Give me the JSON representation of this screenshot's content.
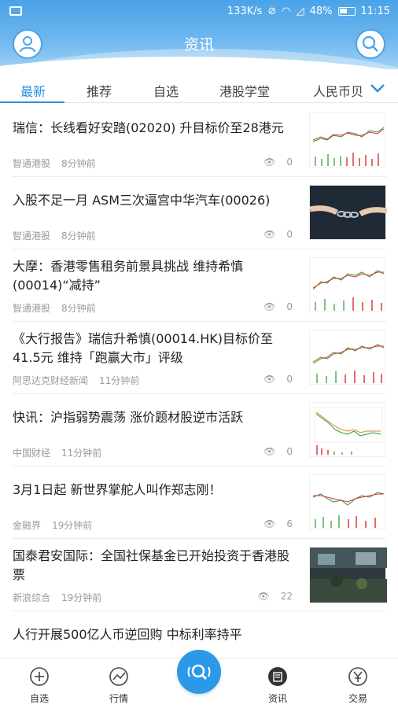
{
  "status_bar": {
    "speed": "133K/s",
    "battery": "48%",
    "time": "11:15"
  },
  "header": {
    "title": "资讯"
  },
  "tabs": [
    {
      "label": "最新",
      "active": true
    },
    {
      "label": "推荐"
    },
    {
      "label": "自选"
    },
    {
      "label": "港股学堂"
    },
    {
      "label": "人民币贝"
    }
  ],
  "news": [
    {
      "title": "瑞信：长线看好安踏(02020) 升目标价至28港元",
      "source": "智通港股",
      "time": "8分钟前",
      "views": "0",
      "thumb": "stock-chart"
    },
    {
      "title": "入股不足一月 ASM三次逼宫中华汽车(00026)",
      "source": "智通港股",
      "time": "8分钟前",
      "views": "0",
      "thumb": "chain-hands-photo"
    },
    {
      "title": "大摩：香港零售租务前景具挑战 维持希慎(00014)“减持”",
      "source": "智通港股",
      "time": "8分钟前",
      "views": "0",
      "thumb": "stock-chart"
    },
    {
      "title": "《大行报告》瑞信升希慎(00014.HK)目标价至41.5元 维持「跑赢大市」评级",
      "source": "阿思达克财经新闻",
      "time": "11分钟前",
      "views": "0",
      "thumb": "stock-chart"
    },
    {
      "title": "快讯：沪指弱势震荡 涨价题材股逆市活跃",
      "source": "中国财经",
      "time": "11分钟前",
      "views": "0",
      "thumb": "index-chart"
    },
    {
      "title": "3月1日起 新世界掌舵人叫作郑志刚！",
      "source": "金融界",
      "time": "19分钟前",
      "views": "6",
      "thumb": "stock-chart"
    },
    {
      "title": "国泰君安国际：全国社保基金已开始投资于香港股票",
      "source": "新浪综合",
      "time": "19分钟前",
      "views": "22",
      "thumb": "trading-floor-photo"
    },
    {
      "title": "人行开展500亿人币逆回购 中标利率持平",
      "source": "",
      "time": "",
      "views": "",
      "thumb": ""
    }
  ],
  "bottom_nav": [
    {
      "label": "自选",
      "icon": "plus-circle-icon"
    },
    {
      "label": "行情",
      "icon": "trend-icon"
    },
    {
      "label": "",
      "icon": "search-center-icon"
    },
    {
      "label": "资讯",
      "icon": "news-icon"
    },
    {
      "label": "交易",
      "icon": "yen-icon"
    }
  ],
  "colors": {
    "accent": "#2b8fe0",
    "header": "#4aa3e8"
  }
}
